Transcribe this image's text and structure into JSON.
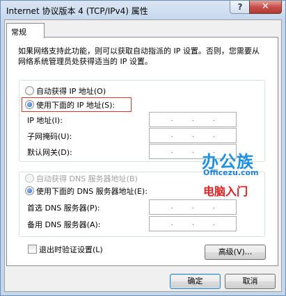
{
  "window": {
    "title": "Internet 协议版本 4 (TCP/IPv4) 属性",
    "help": "?",
    "close": "✕"
  },
  "tab": {
    "label": "常规"
  },
  "description": "如果网络支持此功能，则可以获取自动指派的 IP 设置。否则，您需要从网络系统管理员处获得适当的 IP 设置。",
  "ip": {
    "auto_label": "自动获得 IP 地址(O)",
    "manual_label": "使用下面的 IP 地址(S):",
    "selected": "manual",
    "fields": [
      {
        "label": "IP 地址(I):",
        "value": ". . ."
      },
      {
        "label": "子网掩码(U):",
        "value": ". . ."
      },
      {
        "label": "默认网关(D):",
        "value": ". . ."
      }
    ]
  },
  "dns": {
    "auto_label": "自动获得 DNS 服务器地址(B)",
    "manual_label": "使用下面的 DNS 服务器地址(E):",
    "selected": "manual",
    "fields": [
      {
        "label": "首选 DNS 服务器(P):",
        "value": ". . ."
      },
      {
        "label": "备用 DNS 服务器(A):",
        "value": ". . ."
      }
    ]
  },
  "validate_label": "退出时验证设置(L)",
  "validate_checked": false,
  "advanced_label": "高级(V)...",
  "ok_label": "确定",
  "cancel_label": "取消",
  "watermark": {
    "line1": "办公族",
    "line2": "Officezu.com",
    "line3": "电脑入门"
  },
  "colors": {
    "highlight_border": "#e0302a",
    "close_button": "#c75050",
    "watermark_blue": "#1f8fe0",
    "watermark_red": "#e02020"
  }
}
